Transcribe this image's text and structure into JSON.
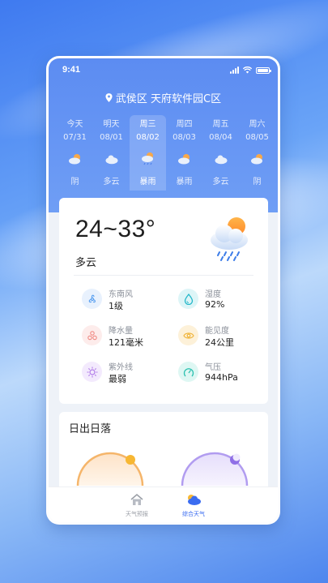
{
  "status_bar": {
    "time": "9:41"
  },
  "location": "武侯区 天府软件园C区",
  "forecast": [
    {
      "day": "今天",
      "date": "07/31",
      "condition": "阴",
      "icon": "cloudy-sun-icon"
    },
    {
      "day": "明天",
      "date": "08/01",
      "condition": "多云",
      "icon": "cloud-icon"
    },
    {
      "day": "周三",
      "date": "08/02",
      "condition": "暴雨",
      "icon": "rain-sun-icon",
      "active": true
    },
    {
      "day": "周四",
      "date": "08/03",
      "condition": "暴雨",
      "icon": "cloudy-sun-icon"
    },
    {
      "day": "周五",
      "date": "08/04",
      "condition": "多云",
      "icon": "cloud-icon"
    },
    {
      "day": "周六",
      "date": "08/05",
      "condition": "阴",
      "icon": "cloudy-sun-icon"
    }
  ],
  "today": {
    "temp_range": "24~33°",
    "condition": "多云",
    "icon": "rain-cloud-sun-icon"
  },
  "details": [
    {
      "label": "东南风",
      "value": "1级",
      "icon": "wind-icon",
      "color": "#5aa0f0",
      "bg": "#e8f1fd"
    },
    {
      "label": "湿度",
      "value": "92%",
      "icon": "droplet-icon",
      "color": "#23b7c9",
      "bg": "#ddf5f7"
    },
    {
      "label": "降水量",
      "value": "121毫米",
      "icon": "rain-drops-icon",
      "color": "#f08a84",
      "bg": "#fdeceb"
    },
    {
      "label": "能见度",
      "value": "24公里",
      "icon": "eye-icon",
      "color": "#f0b43a",
      "bg": "#fdf1d9"
    },
    {
      "label": "紫外线",
      "value": "最弱",
      "icon": "uv-sun-icon",
      "color": "#b07ae8",
      "bg": "#f3eafd"
    },
    {
      "label": "气压",
      "value": "944hPa",
      "icon": "gauge-icon",
      "color": "#2cc1b0",
      "bg": "#def7f3"
    }
  ],
  "sun_section": {
    "title": "日出日落"
  },
  "tabbar": {
    "tabs": [
      {
        "label": "天气预报",
        "icon": "house-icon",
        "active": false
      },
      {
        "label": "综合天气",
        "icon": "weather-cloud-icon",
        "active": true
      }
    ]
  },
  "colors": {
    "accent": "#3b6cf0",
    "header": "#6f9ef5",
    "sunrise": "#f5b041",
    "sunset": "#a98cf0"
  }
}
